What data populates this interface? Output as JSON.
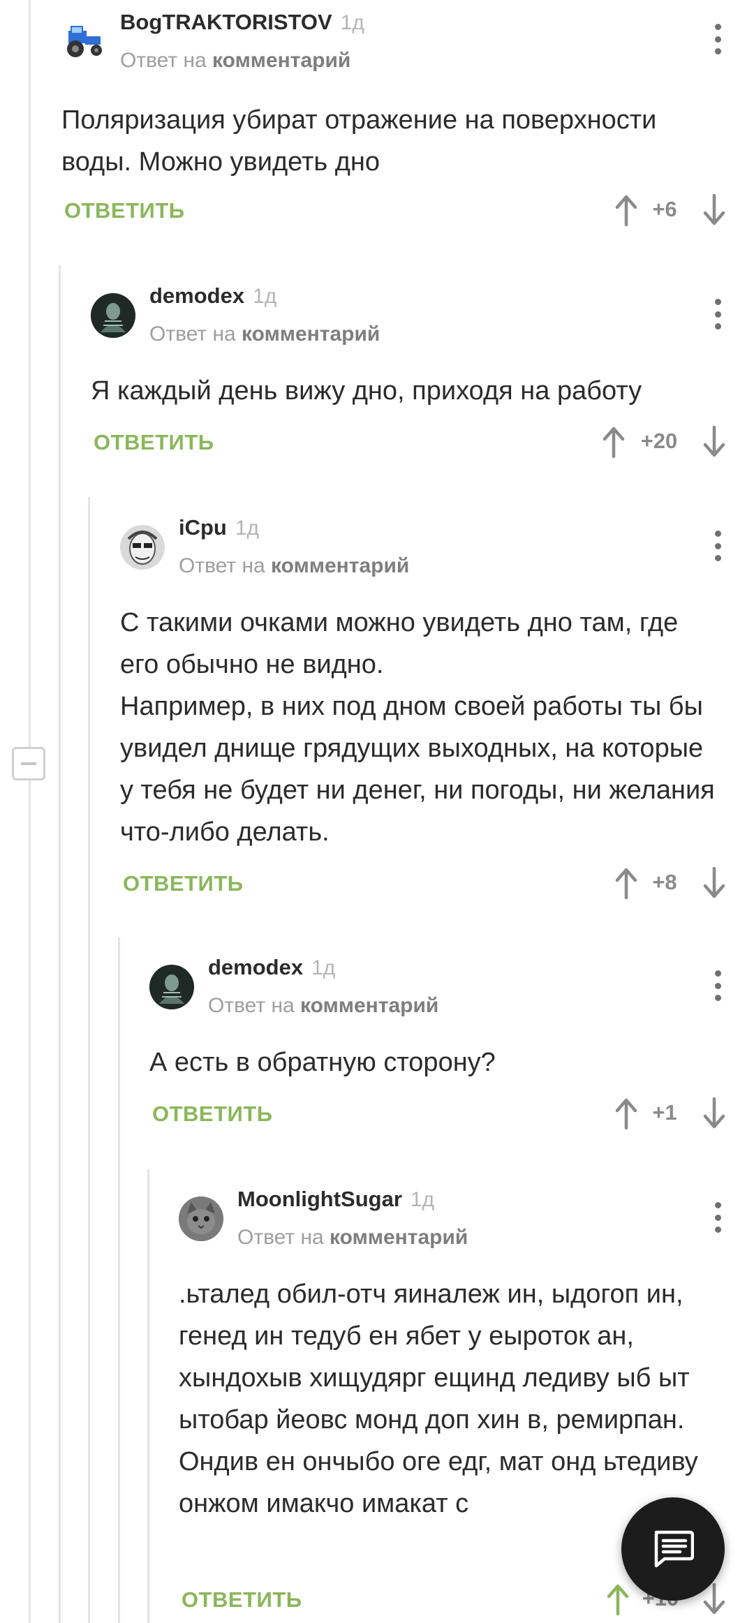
{
  "comments": [
    {
      "author": "BogTRAKTORISTOV",
      "time": "1д",
      "reply_prefix": "Ответ на",
      "reply_link": "комментарий",
      "text": "Поляризация убират отражение на поверхности воды. Можно увидеть дно",
      "reply_label": "ОТВЕТИТЬ",
      "score": "+6",
      "avatar": "blue-tractor-avatar"
    },
    {
      "author": "demodex",
      "time": "1д",
      "reply_prefix": "Ответ на",
      "reply_link": "комментарий",
      "text": "Я каждый день вижу дно, приходя на работу",
      "reply_label": "ОТВЕТИТЬ",
      "score": "+20",
      "avatar": "xray-avatar"
    },
    {
      "author": "iCpu",
      "time": "1д",
      "reply_prefix": "Ответ на",
      "reply_link": "комментарий",
      "text": "С такими очками можно увидеть дно там, где его обычно не видно.\nНапример, в них под дном своей работы ты бы увидел днище грядущих выходных, на которые у тебя не будет ни денег, ни погоды, ни желания что-либо делать.",
      "reply_label": "ОТВЕТИТЬ",
      "score": "+8",
      "avatar": "face-avatar"
    },
    {
      "author": "demodex",
      "time": "1д",
      "reply_prefix": "Ответ на",
      "reply_link": "комментарий",
      "text": "А есть в обратную сторону?",
      "reply_label": "ОТВЕТИТЬ",
      "score": "+1",
      "avatar": "xray-avatar"
    },
    {
      "author": "MoonlightSugar",
      "time": "1д",
      "reply_prefix": "Ответ на",
      "reply_link": "комментарий",
      "text": ".ьталед обил-отч яиналеж ин, ыдогоп ин, генед ин тедуб ен ябет у еыроток ан, хындохыв хищудярг ещинд ледиву ыб ыт ытобар йеовс монд доп хин в, ремирпан. Ондив ен ончыбо оге едг, мат онд ьтедиву онжом имакчо имакат с",
      "reply_label": "ОТВЕТИТЬ",
      "score": "+10",
      "avatar": "cat-avatar"
    }
  ],
  "icons": {
    "upvote": "arrow-up-icon",
    "downvote": "arrow-down-icon",
    "menu": "more-vertical-icon",
    "collapse": "minus-icon",
    "fab": "comment-icon"
  },
  "colors": {
    "accent_green": "#8ab75a",
    "text": "#2b2b2b",
    "muted": "#9e9e9e",
    "fab_bg": "#1c1c1c"
  }
}
